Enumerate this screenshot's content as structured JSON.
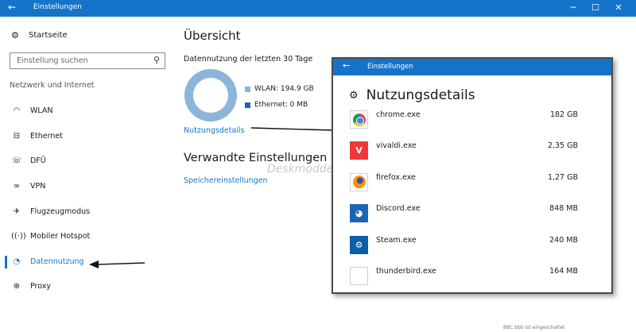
{
  "main_window": {
    "title": "Einstellungen",
    "controls": {
      "minimize": "─",
      "maximize": "☐",
      "close": "✕"
    }
  },
  "sidebar": {
    "home_label": "Startseite",
    "search_placeholder": "Einstellung suchen",
    "section_label": "Netzwerk und Internet",
    "items": [
      {
        "label": "WLAN",
        "icon": "wifi-icon"
      },
      {
        "label": "Ethernet",
        "icon": "ethernet-icon"
      },
      {
        "label": "DFÜ",
        "icon": "dialup-icon"
      },
      {
        "label": "VPN",
        "icon": "vpn-icon"
      },
      {
        "label": "Flugzeugmodus",
        "icon": "airplane-icon"
      },
      {
        "label": "Mobiler Hotspot",
        "icon": "hotspot-icon"
      },
      {
        "label": "Datennutzung",
        "icon": "data-usage-icon",
        "active": true
      },
      {
        "label": "Proxy",
        "icon": "globe-icon"
      }
    ]
  },
  "main": {
    "heading": "Übersicht",
    "usage_label": "Datennutzung der letzten 30 Tage",
    "legend": [
      {
        "label": "WLAN: 194.9 GB",
        "color": "#8cb5d9"
      },
      {
        "label": "Ethernet: 0 MB",
        "color": "#1e64b5"
      }
    ],
    "details_link": "Nutzungsdetails",
    "related_heading": "Verwandte Einstellungen",
    "storage_link": "Speichereinstellungen",
    "watermark": "Deskmodder.de"
  },
  "overlay": {
    "title": "Einstellungen",
    "heading": "Nutzungsdetails",
    "apps": [
      {
        "name": "chrome.exe",
        "size": "182 GB",
        "icon": "chrome-icon"
      },
      {
        "name": "vivaldi.exe",
        "size": "2,35 GB",
        "icon": "vivaldi-icon"
      },
      {
        "name": "firefox.exe",
        "size": "1,27 GB",
        "icon": "firefox-icon"
      },
      {
        "name": "Discord.exe",
        "size": "848 MB",
        "icon": "discord-icon"
      },
      {
        "name": "Steam.exe",
        "size": "240 MB",
        "icon": "steam-icon"
      },
      {
        "name": "thunderbird.exe",
        "size": "164 MB",
        "icon": "thunderbird-icon"
      }
    ]
  },
  "status_text": "BBC.bbb ist eingeschaltet",
  "accent_color": "#1574c9"
}
